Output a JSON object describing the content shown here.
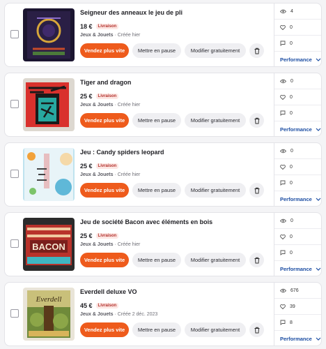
{
  "listings": [
    {
      "title": "Seigneur des anneaux le jeu de pli",
      "price": "18 €",
      "badge": "Livraison",
      "category": "Jeux & Jouets",
      "created": " · Créée hier",
      "stats": {
        "views": "4",
        "likes": "0",
        "messages": "0"
      }
    },
    {
      "title": "Tiger and dragon",
      "price": "25 €",
      "badge": "Livraison",
      "category": "Jeux & Jouets",
      "created": " · Créée hier",
      "stats": {
        "views": "0",
        "likes": "0",
        "messages": "0"
      }
    },
    {
      "title": "Jeu : Candy spiders leopard",
      "price": "25 €",
      "badge": "Livraison",
      "category": "Jeux & Jouets",
      "created": " · Créée hier",
      "stats": {
        "views": "0",
        "likes": "0",
        "messages": "0"
      }
    },
    {
      "title": "Jeu de société Bacon avec éléments en bois",
      "price": "25 €",
      "badge": "Livraison",
      "category": "Jeux & Jouets",
      "created": " · Créée hier",
      "stats": {
        "views": "0",
        "likes": "0",
        "messages": "0"
      }
    },
    {
      "title": "Everdell deluxe VO",
      "price": "45 €",
      "badge": "Livraison",
      "category": "Jeux & Jouets",
      "created": " · Créée 2 déc. 2023",
      "stats": {
        "views": "676",
        "likes": "39",
        "messages": "8"
      }
    }
  ],
  "actions": {
    "boost": "Vendez plus vite",
    "pause": "Mettre en pause",
    "edit": "Modifier gratuitement"
  },
  "performance_label": "Performance",
  "thumbnail_texts": {
    "bacon": "BACON",
    "everdell": "Everdell"
  },
  "icons": {
    "views": "eye-icon",
    "likes": "heart-icon",
    "messages": "chat-icon",
    "delete": "trash-icon",
    "expand": "chevron-down-icon"
  },
  "colors": {
    "accent": "#ee5b1c",
    "badge_bg": "#fde7e4",
    "badge_text": "#b2302c",
    "link": "#1d4ea3"
  }
}
